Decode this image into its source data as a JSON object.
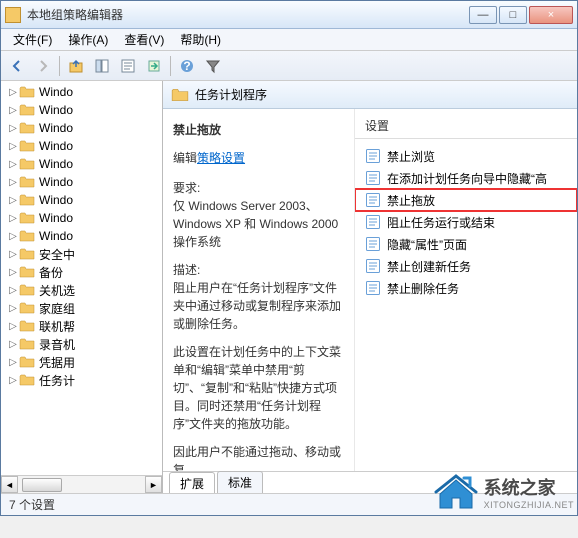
{
  "window": {
    "title": "本地组策略编辑器",
    "min_label": "—",
    "max_label": "□",
    "close_label": "×"
  },
  "menus": [
    {
      "label": "文件(F)"
    },
    {
      "label": "操作(A)"
    },
    {
      "label": "查看(V)"
    },
    {
      "label": "帮助(H)"
    }
  ],
  "tree": {
    "items": [
      {
        "label": "Windo"
      },
      {
        "label": "Windo"
      },
      {
        "label": "Windo"
      },
      {
        "label": "Windo"
      },
      {
        "label": "Windo"
      },
      {
        "label": "Windo"
      },
      {
        "label": "Windo"
      },
      {
        "label": "Windo"
      },
      {
        "label": "Windo"
      },
      {
        "label": "安全中"
      },
      {
        "label": "备份"
      },
      {
        "label": "关机选"
      },
      {
        "label": "家庭组"
      },
      {
        "label": "联机帮"
      },
      {
        "label": "录音机"
      },
      {
        "label": "凭据用"
      },
      {
        "label": "任务计"
      }
    ]
  },
  "detail": {
    "category": "任务计划程序",
    "heading": "禁止拖放",
    "edit_prefix": "编辑",
    "edit_link": "策略设置",
    "req_label": "要求:",
    "req_text": "仅 Windows Server 2003、Windows XP 和 Windows 2000 操作系统",
    "desc_label": "描述:",
    "desc_text1": "阻止用户在“任务计划程序”文件夹中通过移动或复制程序来添加或删除任务。",
    "desc_text2": "此设置在计划任务中的上下文菜单和“编辑”菜单中禁用“剪切”、“复制”和“粘贴”快捷方式项目。同时还禁用“任务计划程序”文件夹的拖放功能。",
    "desc_text3": "因此用户不能通过拖动、移动或复",
    "col_header": "设置",
    "settings": [
      {
        "label": "禁止浏览",
        "hl": false
      },
      {
        "label": "在添加计划任务向导中隐藏“高",
        "hl": false
      },
      {
        "label": "禁止拖放",
        "hl": true
      },
      {
        "label": "阻止任务运行或结束",
        "hl": false
      },
      {
        "label": "隐藏“属性”页面",
        "hl": false
      },
      {
        "label": "禁止创建新任务",
        "hl": false
      },
      {
        "label": "禁止删除任务",
        "hl": false
      }
    ]
  },
  "tabs": {
    "extended": "扩展",
    "standard": "标准"
  },
  "status": "7 个设置",
  "watermark": {
    "line1": "系统之家",
    "line2": "XITONGZHIJIA.NET"
  }
}
